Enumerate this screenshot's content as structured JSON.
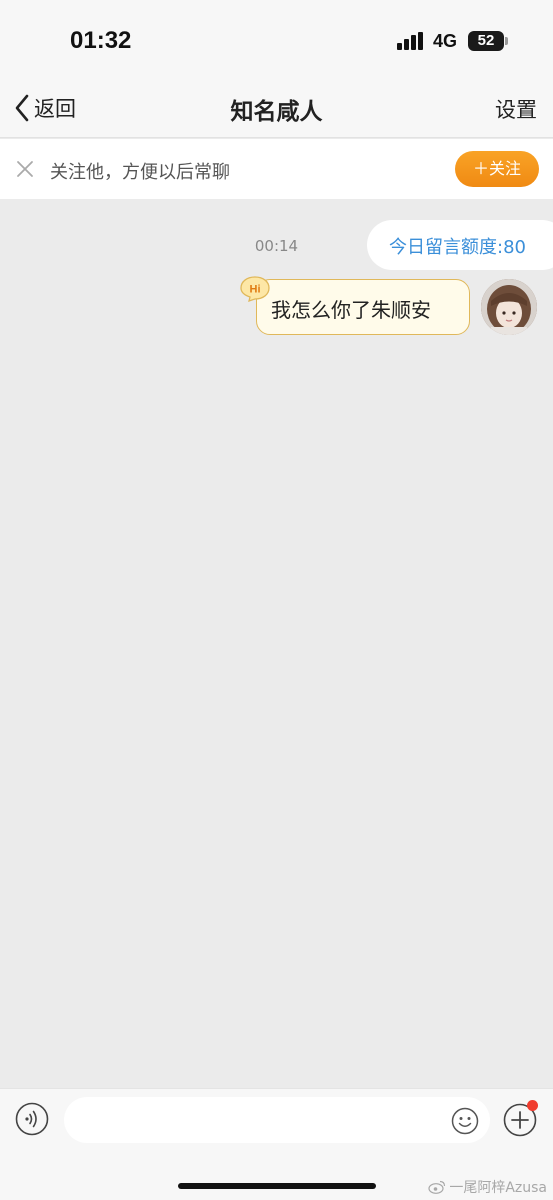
{
  "status_bar": {
    "time": "01:32",
    "network": "4G",
    "battery": "52"
  },
  "nav": {
    "back_label": "返回",
    "title": "知名咸人",
    "settings_label": "设置"
  },
  "follow_banner": {
    "text": "关注他，方便以后常聊",
    "button_label": "＋关注"
  },
  "chat": {
    "quota_text": "今日留言额度:80",
    "messages": [
      {
        "time": "00:14",
        "text": "我怎么你了朱顺安",
        "badge": "Hi"
      }
    ]
  },
  "input_bar": {
    "placeholder": ""
  },
  "watermark": "一尾阿梓Azusa",
  "colors": {
    "accent_orange": "#f39217",
    "link_blue": "#3b8fd9",
    "bubble_bg": "#fffbea",
    "bubble_border": "#e0b85a",
    "badge_red": "#f03c2e",
    "background": "#ebebeb"
  },
  "icons": {
    "back": "chevron-left-icon",
    "close": "close-icon",
    "voice": "voice-icon",
    "emoji": "emoji-icon",
    "plus": "plus-icon",
    "signal": "signal-bars-icon",
    "battery": "battery-icon"
  }
}
